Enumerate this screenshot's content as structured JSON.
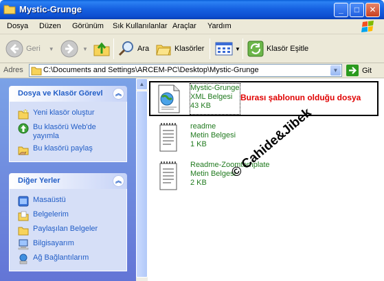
{
  "window": {
    "title": "Mystic-Grunge",
    "minimize_label": "_",
    "maximize_label": "□",
    "close_label": "✕"
  },
  "menu": {
    "items": [
      "Dosya",
      "Düzen",
      "Görünüm",
      "Sık Kullanılanlar",
      "Araçlar",
      "Yardım"
    ]
  },
  "toolbar": {
    "back_label": "Geri",
    "search_label": "Ara",
    "folders_label": "Klasörler",
    "sync_label": "Klasör Eşitle"
  },
  "address": {
    "label": "Adres",
    "path": "C:\\Documents and Settings\\ARCEM-PC\\Desktop\\Mystic-Grunge",
    "go_label": "Git"
  },
  "taskpane": {
    "panel1": {
      "title": "Dosya ve Klasör Görevl",
      "items": [
        {
          "label": "Yeni klasör oluştur",
          "icon": "new-folder-icon"
        },
        {
          "label": "Bu klasörü Web'de yayımla",
          "icon": "publish-web-icon"
        },
        {
          "label": "Bu klasörü paylaş",
          "icon": "share-folder-icon"
        }
      ]
    },
    "panel2": {
      "title": "Diğer Yerler",
      "items": [
        {
          "label": "Masaüstü",
          "icon": "desktop-icon"
        },
        {
          "label": "Belgelerim",
          "icon": "my-documents-icon"
        },
        {
          "label": "Paylaşılan Belgeler",
          "icon": "shared-documents-icon"
        },
        {
          "label": "Bilgisayarım",
          "icon": "my-computer-icon"
        },
        {
          "label": "Ağ Bağlantılarım",
          "icon": "network-icon"
        }
      ]
    }
  },
  "files": [
    {
      "name": "Mystic-Grunge",
      "type": "XML Belgesi",
      "size": "43 KB",
      "icon": "xml-document-icon",
      "selected": true
    },
    {
      "name": "readme",
      "type": "Metin Belgesi",
      "size": "1 KB",
      "icon": "text-document-icon"
    },
    {
      "name": "Readme-Zoomtemplate",
      "type": "Metin Belgesi",
      "size": "2 KB",
      "icon": "text-document-icon"
    }
  ],
  "annotation": {
    "text": "Burası şablonun olduğu dosya",
    "color": "#e00000"
  },
  "watermark": "© Cahide&Jibek",
  "colors": {
    "titlebar": "#0d4fd1",
    "link": "#215dc6",
    "file_text": "#217a1f"
  }
}
